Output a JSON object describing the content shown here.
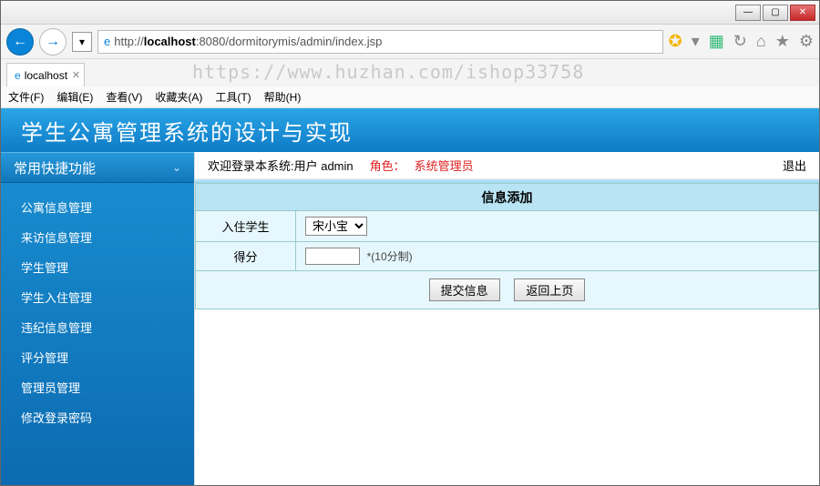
{
  "window": {
    "min": "—",
    "max": "▢",
    "close": "✕"
  },
  "browser": {
    "url_prefix": "http://",
    "url_host": "localhost",
    "url_rest": ":8080/dormitorymis/admin/index.jsp",
    "tab_title": "localhost",
    "watermark": "https://www.huzhan.com/ishop33758"
  },
  "menu": {
    "file": "文件(F)",
    "edit": "编辑(E)",
    "view": "查看(V)",
    "favorites": "收藏夹(A)",
    "tools": "工具(T)",
    "help": "帮助(H)"
  },
  "app": {
    "title": "学生公寓管理系统的设计与实现"
  },
  "sidebar": {
    "header": "常用快捷功能",
    "items": [
      "公寓信息管理",
      "来访信息管理",
      "学生管理",
      "学生入住管理",
      "违纪信息管理",
      "评分管理",
      "管理员管理",
      "修改登录密码"
    ]
  },
  "welcome": {
    "text": "欢迎登录本系统:用户  admin",
    "role_label": "角色：",
    "role_value": "系统管理员",
    "logout": "退出"
  },
  "form": {
    "title": "信息添加",
    "row1_label": "入住学生",
    "row1_value": "宋小宝",
    "row2_label": "得分",
    "row2_value": "",
    "row2_hint": "*(10分制)",
    "submit": "提交信息",
    "back": "返回上页"
  }
}
